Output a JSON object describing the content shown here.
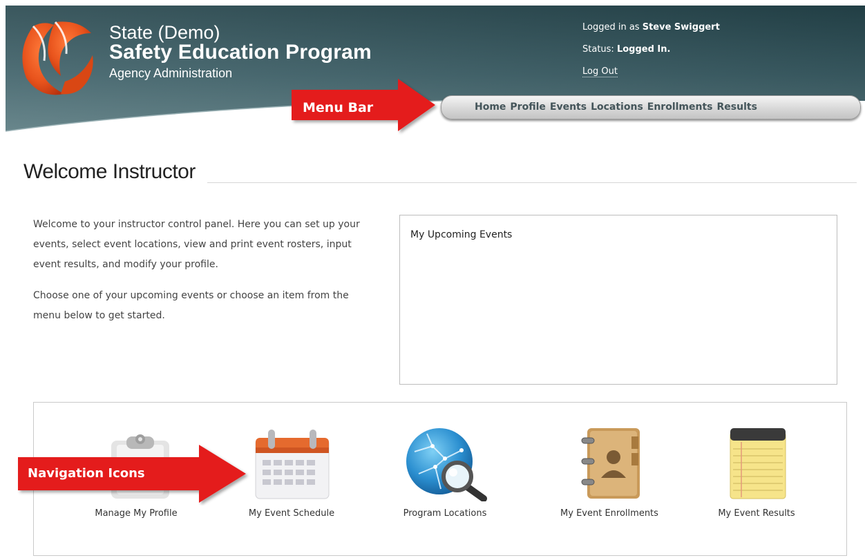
{
  "brand": {
    "line1": "State (Demo)",
    "line2": "Safety Education Program",
    "line3": "Agency Administration"
  },
  "user": {
    "logged_in_prefix": "Logged in as",
    "name": "Steve Swiggert",
    "status_prefix": "Status:",
    "status": "Logged In.",
    "logout": "Log Out"
  },
  "menu": {
    "items": [
      "Home",
      "Profile",
      "Events",
      "Locations",
      "Enrollments",
      "Results"
    ]
  },
  "callouts": {
    "menu_bar": "Menu Bar",
    "navigation_icons": "Navigation Icons"
  },
  "page": {
    "title": "Welcome Instructor",
    "intro_p1": "Welcome to your instructor control panel. Here you can set up your events, select event locations, view and print event rosters, input event results, and modify your profile.",
    "intro_p2": "Choose one of your upcoming events or choose an item from the menu below to get started."
  },
  "upcoming": {
    "title": "My Upcoming Events"
  },
  "nav_icons": [
    {
      "label": "Manage My Profile",
      "icon": "profile-icon"
    },
    {
      "label": "My Event Schedule",
      "icon": "calendar-icon"
    },
    {
      "label": "Program Locations",
      "icon": "globe-magnifier-icon"
    },
    {
      "label": "My Event Enrollments",
      "icon": "address-book-icon"
    },
    {
      "label": "My Event Results",
      "icon": "notepad-icon"
    }
  ],
  "colors": {
    "header_dark": "#2f5057",
    "header_light": "#5d8088",
    "accent_orange": "#e8531c",
    "callout_red": "#e41f1f"
  }
}
